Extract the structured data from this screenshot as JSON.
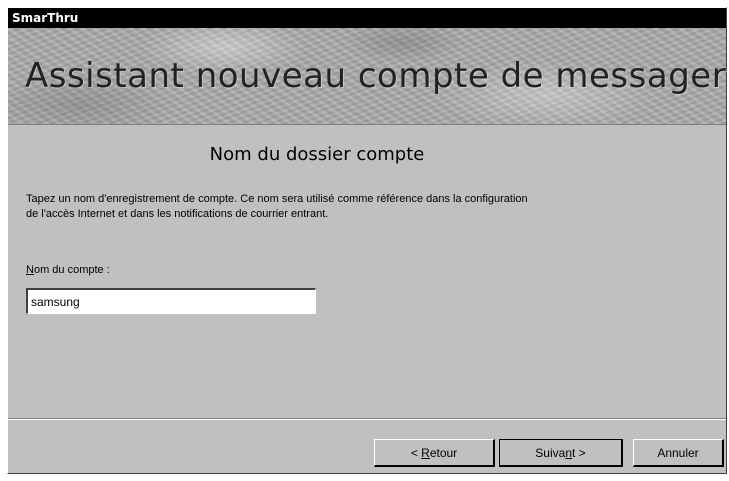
{
  "window": {
    "title": "SmarThru"
  },
  "banner": {
    "title": "Assistant nouveau compte de messagerie"
  },
  "section": {
    "title": "Nom du dossier compte"
  },
  "description": {
    "line1": "Tapez un nom d'enregistrement de compte. Ce nom sera utilisé comme référence dans la configuration",
    "line2": "de l'accès Internet et dans les notifications de courrier entrant."
  },
  "account_field": {
    "label_mnemonic": "N",
    "label_rest": "om du compte :",
    "value": "samsung"
  },
  "buttons": {
    "back": {
      "prefix": "< ",
      "mnemonic": "R",
      "rest": "etour"
    },
    "next": {
      "prefix": "Suiva",
      "mnemonic": "n",
      "rest": "t >"
    },
    "cancel": {
      "label": "Annuler"
    }
  }
}
